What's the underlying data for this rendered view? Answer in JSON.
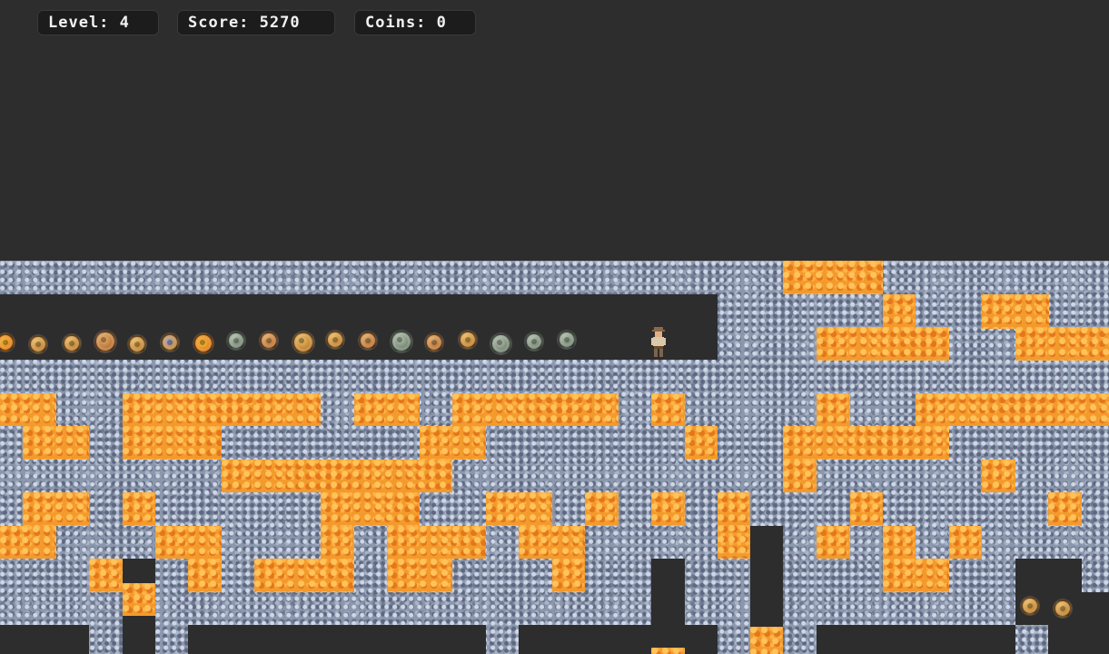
{
  "hud": {
    "level_label": "Level:",
    "level_value": "4",
    "score_label": "Score:",
    "score_value": "5270",
    "coins_label": "Coins:",
    "coins_value": "0"
  },
  "colors": {
    "background": "#2d2d2d",
    "stone": "#8b97ad",
    "lava": "#f39a2c",
    "hud_box": "#1c1c1c",
    "hud_text": "#f2f2f2"
  },
  "icons": {
    "player": "explorer-sprite",
    "coin": "ancient-coin-icon"
  }
}
